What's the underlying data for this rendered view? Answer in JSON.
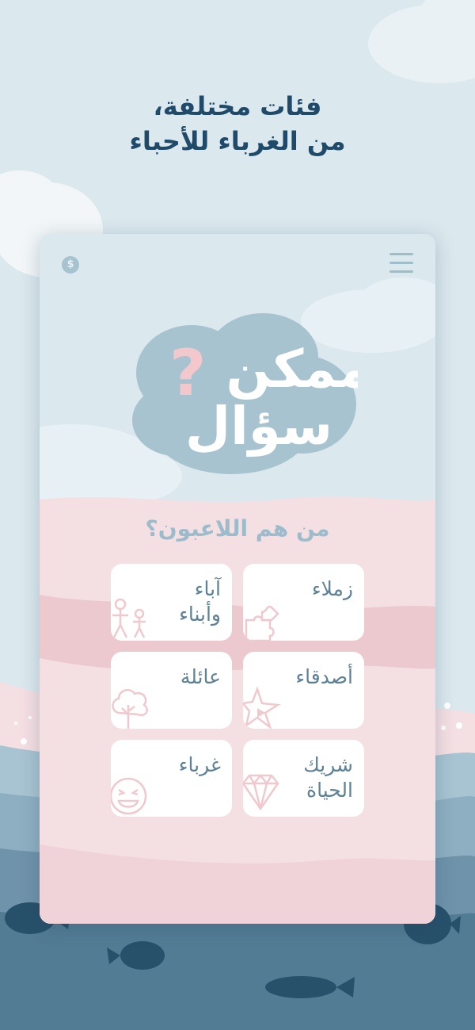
{
  "headline": {
    "line1": "فئات مختلفة،",
    "line2": "من الغرباء للأحباء"
  },
  "app": {
    "logo": {
      "text_line1": "ممكن",
      "text_line2": "سؤال",
      "mark": "?"
    },
    "coin_label": "$",
    "question": "من هم اللاعبون؟",
    "categories": [
      {
        "label": "زملاء",
        "icon": "puzzle-icon"
      },
      {
        "label": "آباء\nوأبناء",
        "icon": "parent-child-icon"
      },
      {
        "label": "أصدقاء",
        "icon": "star-icon"
      },
      {
        "label": "عائلة",
        "icon": "tree-icon"
      },
      {
        "label": "شريك\nالحياة",
        "icon": "diamond-icon"
      },
      {
        "label": "غرباء",
        "icon": "smiley-icon"
      }
    ]
  },
  "colors": {
    "background_sky": "#dbe8ee",
    "headline": "#1f4a6a",
    "card_text": "#5d8196",
    "question_text": "#9dbccb",
    "pink_wave": "#f3d7dc",
    "deep_water": "#527b94",
    "icon_pink": "#f0c9cf"
  }
}
